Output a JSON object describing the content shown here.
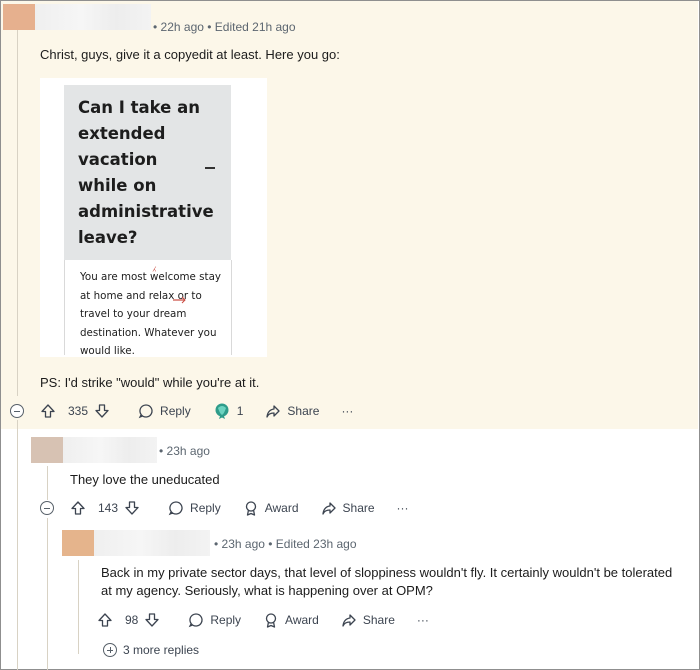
{
  "comment1": {
    "meta": "• 22h ago • Edited 21h ago",
    "text": "Christ, guys, give it a copyedit at least. Here you go:",
    "card": {
      "title": "Can I take an extended vacation while on administrative leave?",
      "body": "You are most welcome stay at home and relax or to travel to your dream destination. Whatever you would like."
    },
    "ps": "PS: I'd strike \"would\" while you're at it.",
    "votes": "335",
    "reply_label": "Reply",
    "award_count": "1",
    "share_label": "Share",
    "more_label": "···"
  },
  "comment2": {
    "meta": "• 23h ago",
    "text": "They love the uneducated",
    "votes": "143",
    "reply_label": "Reply",
    "award_label": "Award",
    "share_label": "Share",
    "more_label": "···"
  },
  "comment3": {
    "meta": "• 23h ago • Edited 23h ago",
    "text_line1": "Back in my private sector days, that level of sloppiness wouldn't fly. It certainly wouldn't be tolerated",
    "text_line2": "at my agency. Seriously, what is happening over at OPM?",
    "votes": "98",
    "reply_label": "Reply",
    "award_label": "Award",
    "share_label": "Share",
    "more_label": "···"
  },
  "more_replies": "3 more replies",
  "colors": {
    "highlight_bg": "#fcf7e9",
    "avatar1": "#e6b08e",
    "avatar2": "#d7c2b3",
    "avatar3": "#e5b48c",
    "edit_mark": "#c94a40"
  }
}
